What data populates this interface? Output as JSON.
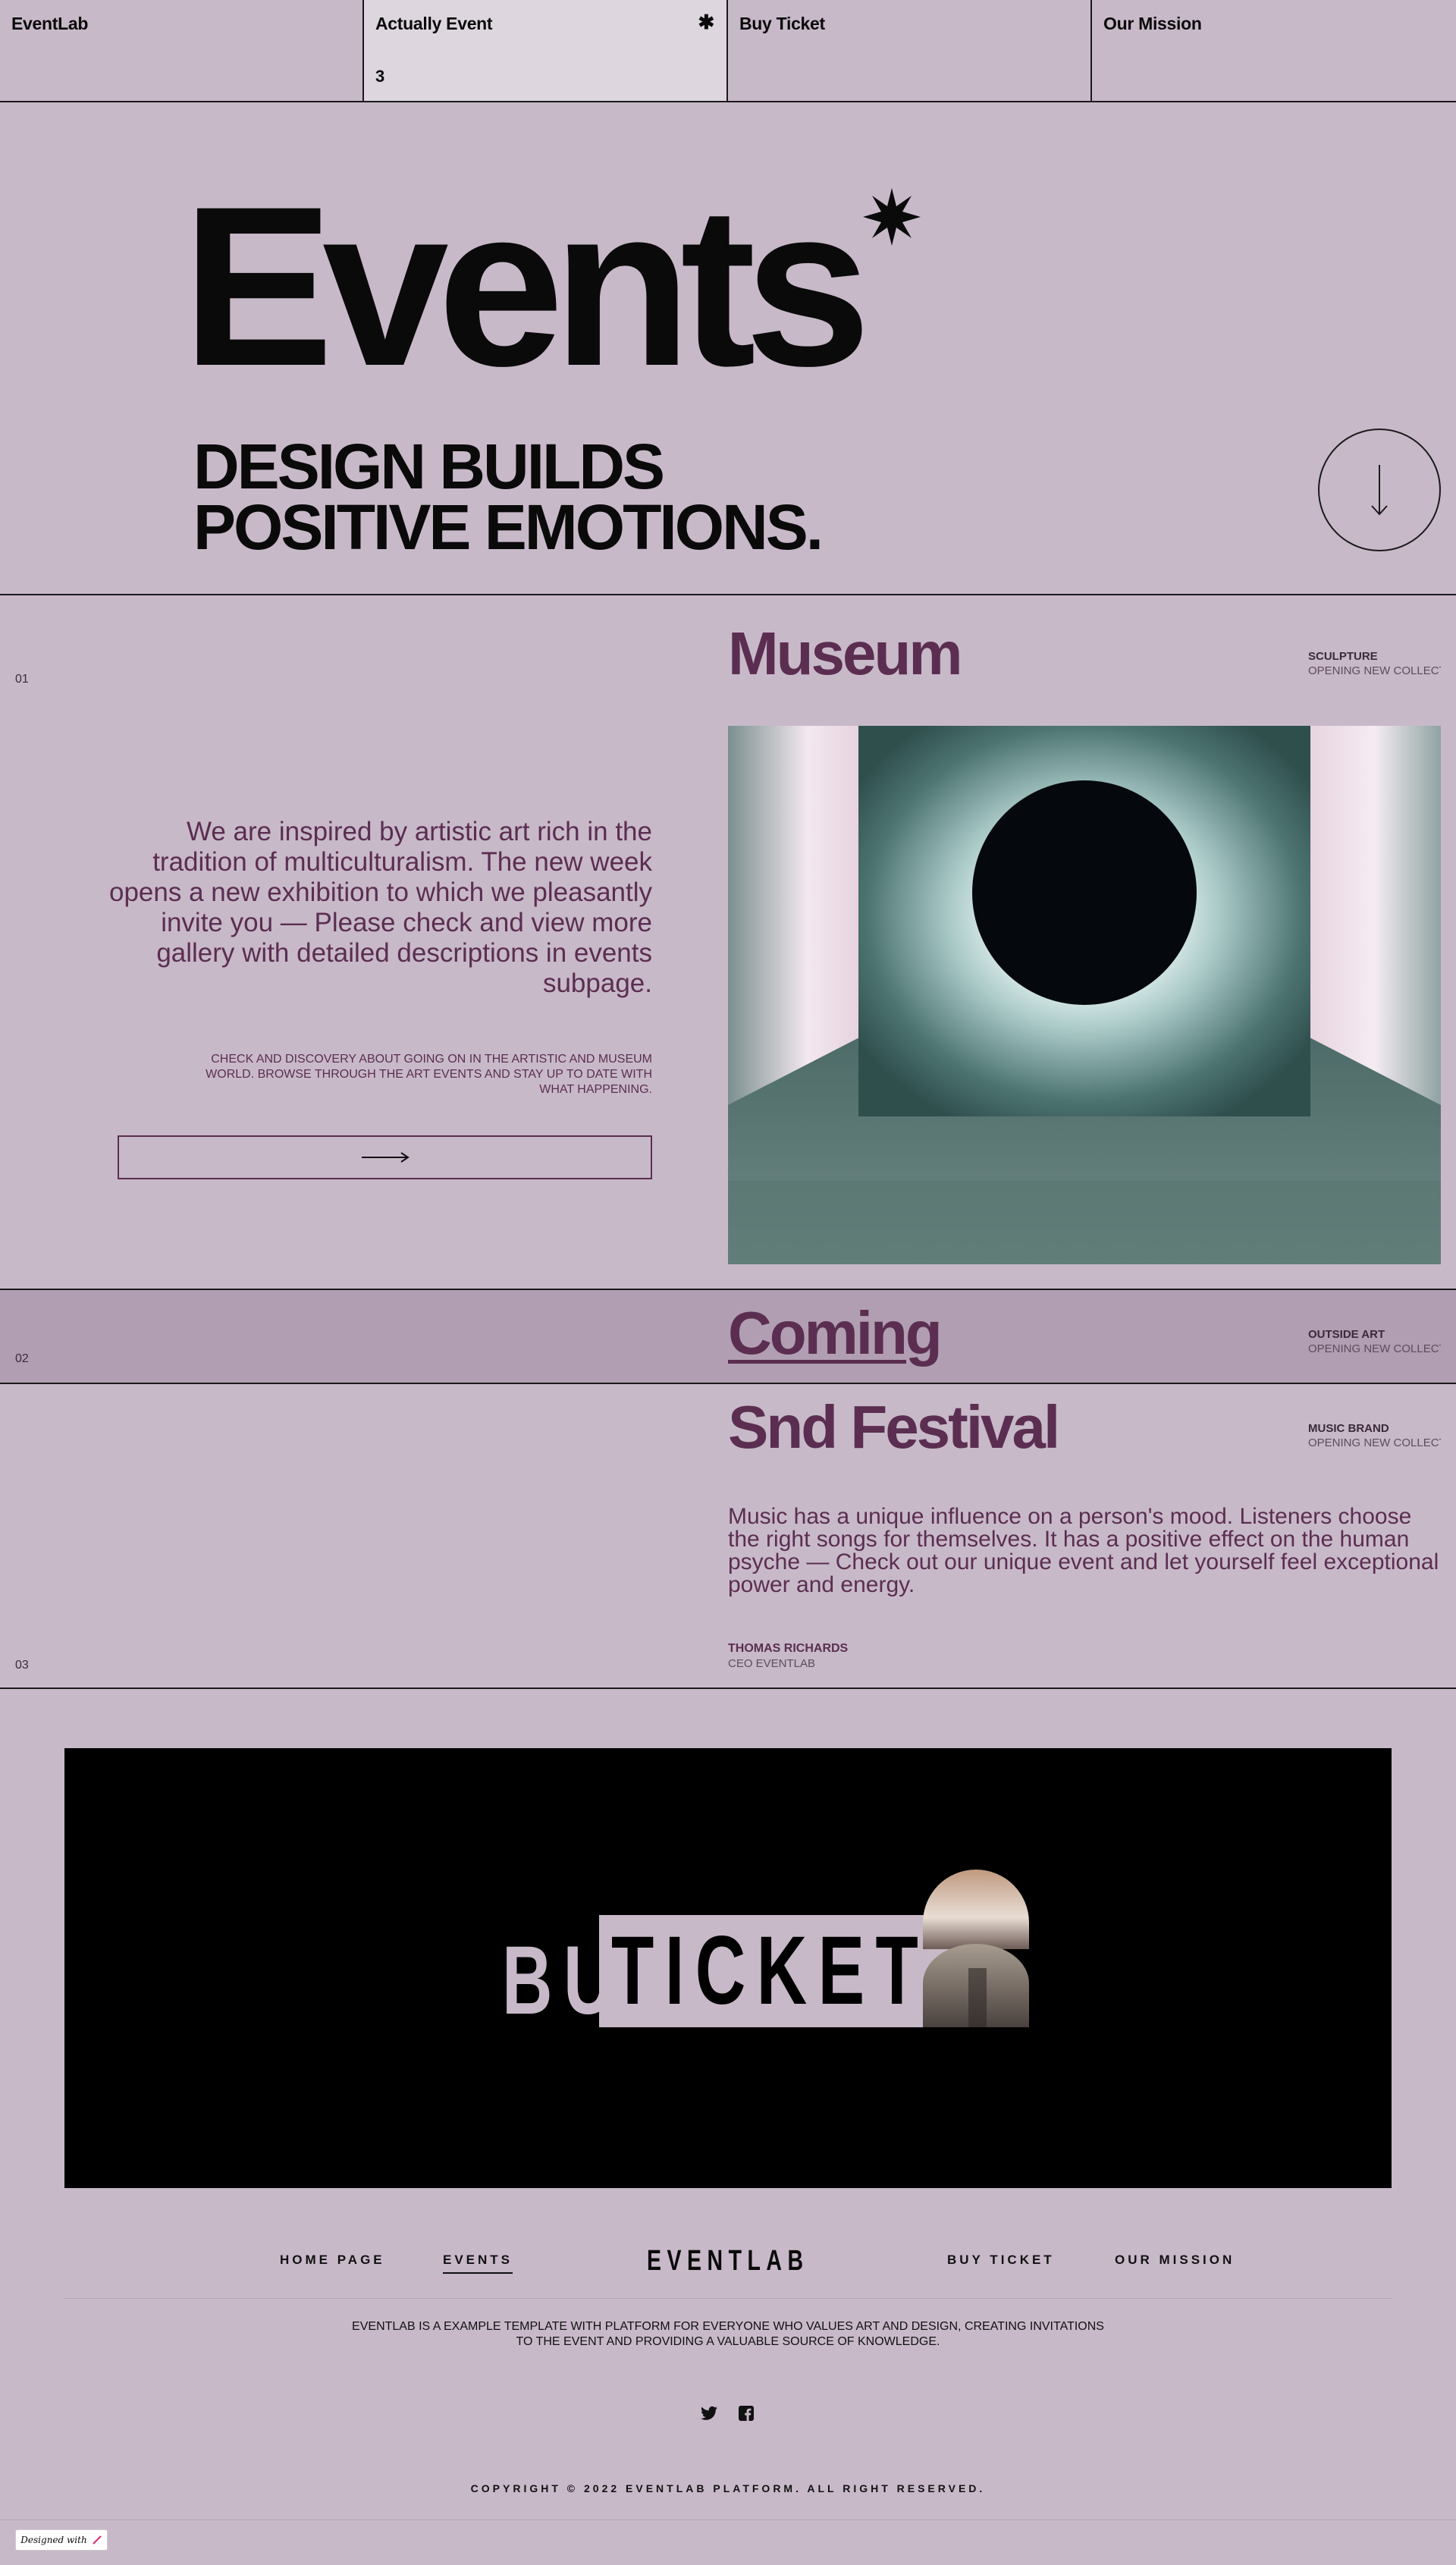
{
  "topnav": {
    "brand": "EventLab",
    "actual_label": "Actually Event",
    "actual_count": "3",
    "star": "✱",
    "buy_label": "Buy Ticket",
    "mission_label": "Our Mission"
  },
  "hero": {
    "title": "Events",
    "subtitle": "DESIGN BUILDS\nPOSITIVE EMOTIONS."
  },
  "events": [
    {
      "num": "01",
      "title": "Museum",
      "tag_primary": "SCULPTURE",
      "tag_secondary": "OPENING NEW COLLECT",
      "lead": "We are inspired by artistic art rich in the tradition of multiculturalism. The new week opens a new exhibition to which we pleasantly invite you — Please check and view more gallery with detailed descriptions in events subpage.",
      "small": "CHECK AND DISCOVERY ABOUT GOING ON IN THE ARTISTIC AND MUSEUM WORLD. BROWSE THROUGH THE ART EVENTS AND STAY UP TO DATE WITH WHAT HAPPENING."
    },
    {
      "num": "02",
      "title": "Coming",
      "tag_primary": "OUTSIDE ART",
      "tag_secondary": "OPENING NEW COLLECT"
    },
    {
      "num": "03",
      "title": "Snd Festival",
      "tag_primary": "MUSIC BRAND",
      "tag_secondary": "OPENING NEW COLLECT",
      "body": "Music has a unique influence on a person's mood. Listeners choose the right songs for themselves. It has a positive effect on the human psyche — Check out our unique event and let yourself feel exceptional power and energy.",
      "author_name": "THOMAS RICHARDS",
      "author_role": "CEO EVENTLAB"
    }
  ],
  "banner": {
    "buy": "BUY",
    "ticket": "TICKET"
  },
  "footer": {
    "nav_home": "HOME PAGE",
    "nav_events": "EVENTS",
    "logo": "EVENTLAB",
    "nav_buy": "BUY TICKET",
    "nav_mission": "OUR MISSION",
    "description": "EVENTLAB IS A EXAMPLE TEMPLATE WITH PLATFORM FOR EVERYONE WHO VALUES ART AND DESIGN, CREATING INVITATIONS TO THE EVENT AND PROVIDING A VALUABLE SOURCE OF KNOWLEDGE.",
    "copyright": "COPYRIGHT © 2022 EVENTLAB PLATFORM. ALL RIGHT RESERVED.",
    "designed_with": "Designed with"
  },
  "colors": {
    "background": "#c8b9c9",
    "accent": "#5b2e51",
    "highlight_row": "#b19eb2",
    "active_tab": "#ded6df"
  },
  "icons": [
    "star-icon",
    "arrow-down-icon",
    "arrow-right-icon",
    "twitter-icon",
    "facebook-icon"
  ]
}
